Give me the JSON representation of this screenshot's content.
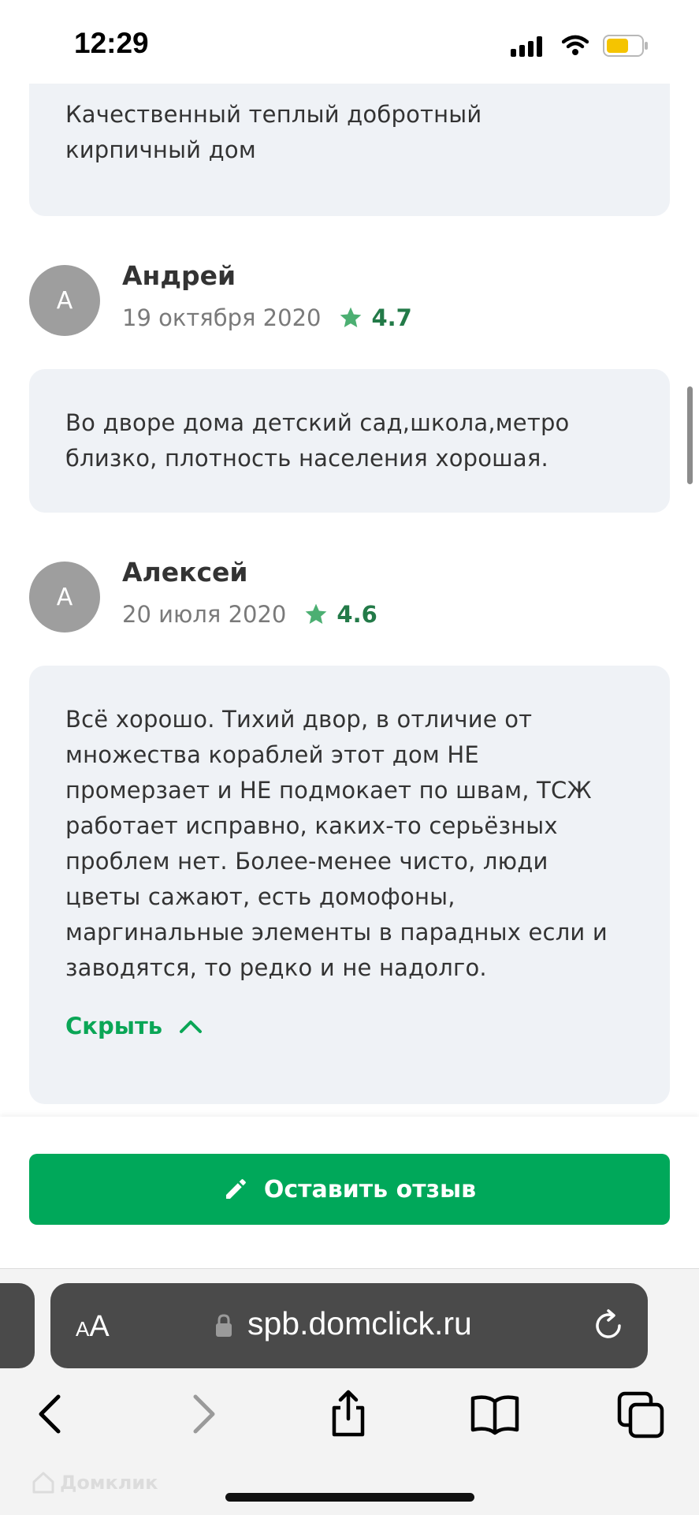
{
  "status_bar": {
    "time": "12:29"
  },
  "reviews_prev": {
    "text": "Качественный теплый добротный\nкирпичный дом"
  },
  "reviews": [
    {
      "avatar": "А",
      "author": "Андрей",
      "date": "19 октября 2020",
      "rating": "4.7",
      "text": "Во дворе дома детский сад,школа,метро\nблизко, плотность населения хорошая."
    },
    {
      "avatar": "А",
      "author": "Алексей",
      "date": "20 июля 2020",
      "rating": "4.6",
      "text": "Всё хорошо. Тихий двор, в отличие от\nмножества кораблей этот дом НЕ\nпромерзает и НЕ подмокает по швам, ТСЖ\nработает исправно, каких-то серьёзных\nпроблем нет. Более-менее чисто, люди\nцветы сажают, есть домофоны,\nмаргинальные элементы в парадных если и\nзаводятся, то редко и не надолго.",
      "hide_label": "Скрыть"
    }
  ],
  "cta": {
    "label": "Оставить отзыв",
    "color": "#00a85a"
  },
  "browser": {
    "aa_small": "A",
    "aa_large": "A",
    "url": "spb.domclick.ru"
  },
  "watermark": "Домклик",
  "colors": {
    "rating_star": "#4caf72",
    "link": "#0aa656",
    "card_bg": "#eff2f6"
  }
}
